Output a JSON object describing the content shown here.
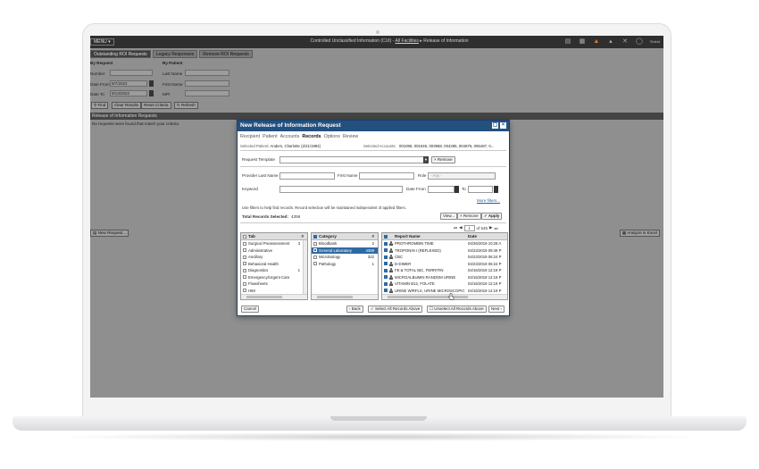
{
  "app": {
    "menu_label": "MENU ▾",
    "title_prefix": "Controlled Unclassified Information (CUI) - ",
    "title_link": "All Facilities",
    "title_suffix": " ▸ Release of Information",
    "user_label": "Shield"
  },
  "tabs": [
    {
      "label": "Outstanding ROI Requests"
    },
    {
      "label": "Legacy Responses"
    },
    {
      "label": "Remove ROI Requests"
    }
  ],
  "search_form": {
    "by_request_heading": "By Request",
    "number_label": "Number",
    "date_from_label": "Date From",
    "date_from_value": "9/7/2022",
    "date_to_label": "Date To",
    "date_to_value": "9/13/2022",
    "by_patient_heading": "By Patient",
    "last_name_label": "Last Name",
    "first_name_label": "First Name",
    "mpi_label": "MPI",
    "find_label": "Find",
    "clear_results_label": "Clear Results",
    "reset_criteria_label": "Reset Criteria",
    "refresh_label": "Refresh"
  },
  "results": {
    "section_title": "Release of Information Requests",
    "empty_message": "No requests were found that match your criteria."
  },
  "page_buttons": {
    "new_request": "New Request...",
    "analyze_excel": "Analyze in Excel"
  },
  "modal": {
    "title": "New Release of Information Request",
    "wizard_steps": [
      "Recipient",
      "Patient",
      "Accounts",
      "Records",
      "Options",
      "Review"
    ],
    "active_step": "Records",
    "selected_patient_label": "Selected Patient:",
    "selected_patient_value": "Anders, Charlotte (2/21/1984)",
    "selected_accounts_label": "Selected Accounts:",
    "selected_accounts_value": "001086, 001545, 003968, 004285, 004876, 005487, 0...",
    "request_template_label": "Request Template",
    "remove_template_label": "Remove",
    "provider_last_name_label": "Provider Last Name",
    "first_name_label": "First Name",
    "role_label": "Role",
    "role_placeholder": "- Any -",
    "keyword_label": "Keyword",
    "date_from_label": "Date From",
    "to_label": "To",
    "more_filters_label": "More filters...",
    "filter_hint": "Use filters to help find records. Record selection will be maintained independent of applied filters.",
    "total_records_label": "Total Records Selected:",
    "total_records_value": "4359",
    "view_label": "View...",
    "remove_label": "Remove",
    "apply_label": "Apply",
    "pager": {
      "current_page": "1",
      "page_of_label": "of 545"
    },
    "tab_list": {
      "headers": {
        "name": "Tab",
        "count": "#"
      },
      "items": [
        {
          "label": "Surgical Preassessment",
          "count": "3"
        },
        {
          "label": "Administrative",
          "count": ""
        },
        {
          "label": "Ancillary",
          "count": ""
        },
        {
          "label": "Behavioral Health",
          "count": ""
        },
        {
          "label": "Diagnostics",
          "count": "1"
        },
        {
          "label": "Emergency/Urgent Care",
          "count": ""
        },
        {
          "label": "Flowsheets",
          "count": ""
        },
        {
          "label": "HIM",
          "count": ""
        }
      ]
    },
    "category_list": {
      "headers": {
        "name": "Category",
        "count": "#"
      },
      "items": [
        {
          "label": "Bloodbank",
          "count": "2",
          "selected": false,
          "checked": false
        },
        {
          "label": "General Laboratory",
          "count": "4359",
          "selected": true,
          "checked": true
        },
        {
          "label": "Microbiology",
          "count": "322",
          "selected": false,
          "checked": false
        },
        {
          "label": "Pathology",
          "count": "1",
          "selected": false,
          "checked": false
        }
      ]
    },
    "report_list": {
      "headers": {
        "name": "Report Name",
        "date": "Date"
      },
      "items": [
        {
          "name": "PROTHROMBIN TIME",
          "date": "04/26/2019 10:28 A"
        },
        {
          "name": "TROPONIN I (REFLEXED)",
          "date": "04/23/2019 09:49 P"
        },
        {
          "name": "CBC",
          "date": "04/23/2019 06:24 P"
        },
        {
          "name": "D-DIMER",
          "date": "04/23/2019 06:24 P"
        },
        {
          "name": "FE & TOTAL IBC, FERRITIN",
          "date": "04/16/2019 12:19 P"
        },
        {
          "name": "MICROALBUMIN RANDOM URINE",
          "date": "04/16/2019 12:19 P"
        },
        {
          "name": "VITAMIN B12, FOLATE",
          "date": "04/16/2019 12:19 P"
        },
        {
          "name": "URINE W/RFLX, URINE MICROSCOPIC",
          "date": "04/16/2019 12:19 P"
        }
      ]
    },
    "cancel_label": "Cancel",
    "back_label": "‹ Back",
    "select_all_label": "Select All Records Above",
    "unselect_all_label": "Unselect All Records Above",
    "next_label": "Next ›"
  },
  "colors": {
    "modal_titlebar": "#24507f",
    "selection": "#2f6aa3",
    "screen_overlay": "#8f8f8f",
    "accent_icon": "#d87a2a"
  },
  "icons": [
    "search-icon",
    "refresh-icon",
    "calendar-icon",
    "chevron-down-icon",
    "close-icon",
    "maximize-icon",
    "checkmark-icon",
    "first-page-icon",
    "prev-page-icon",
    "next-page-icon",
    "last-page-icon",
    "person-icon",
    "hand-cursor-icon"
  ]
}
